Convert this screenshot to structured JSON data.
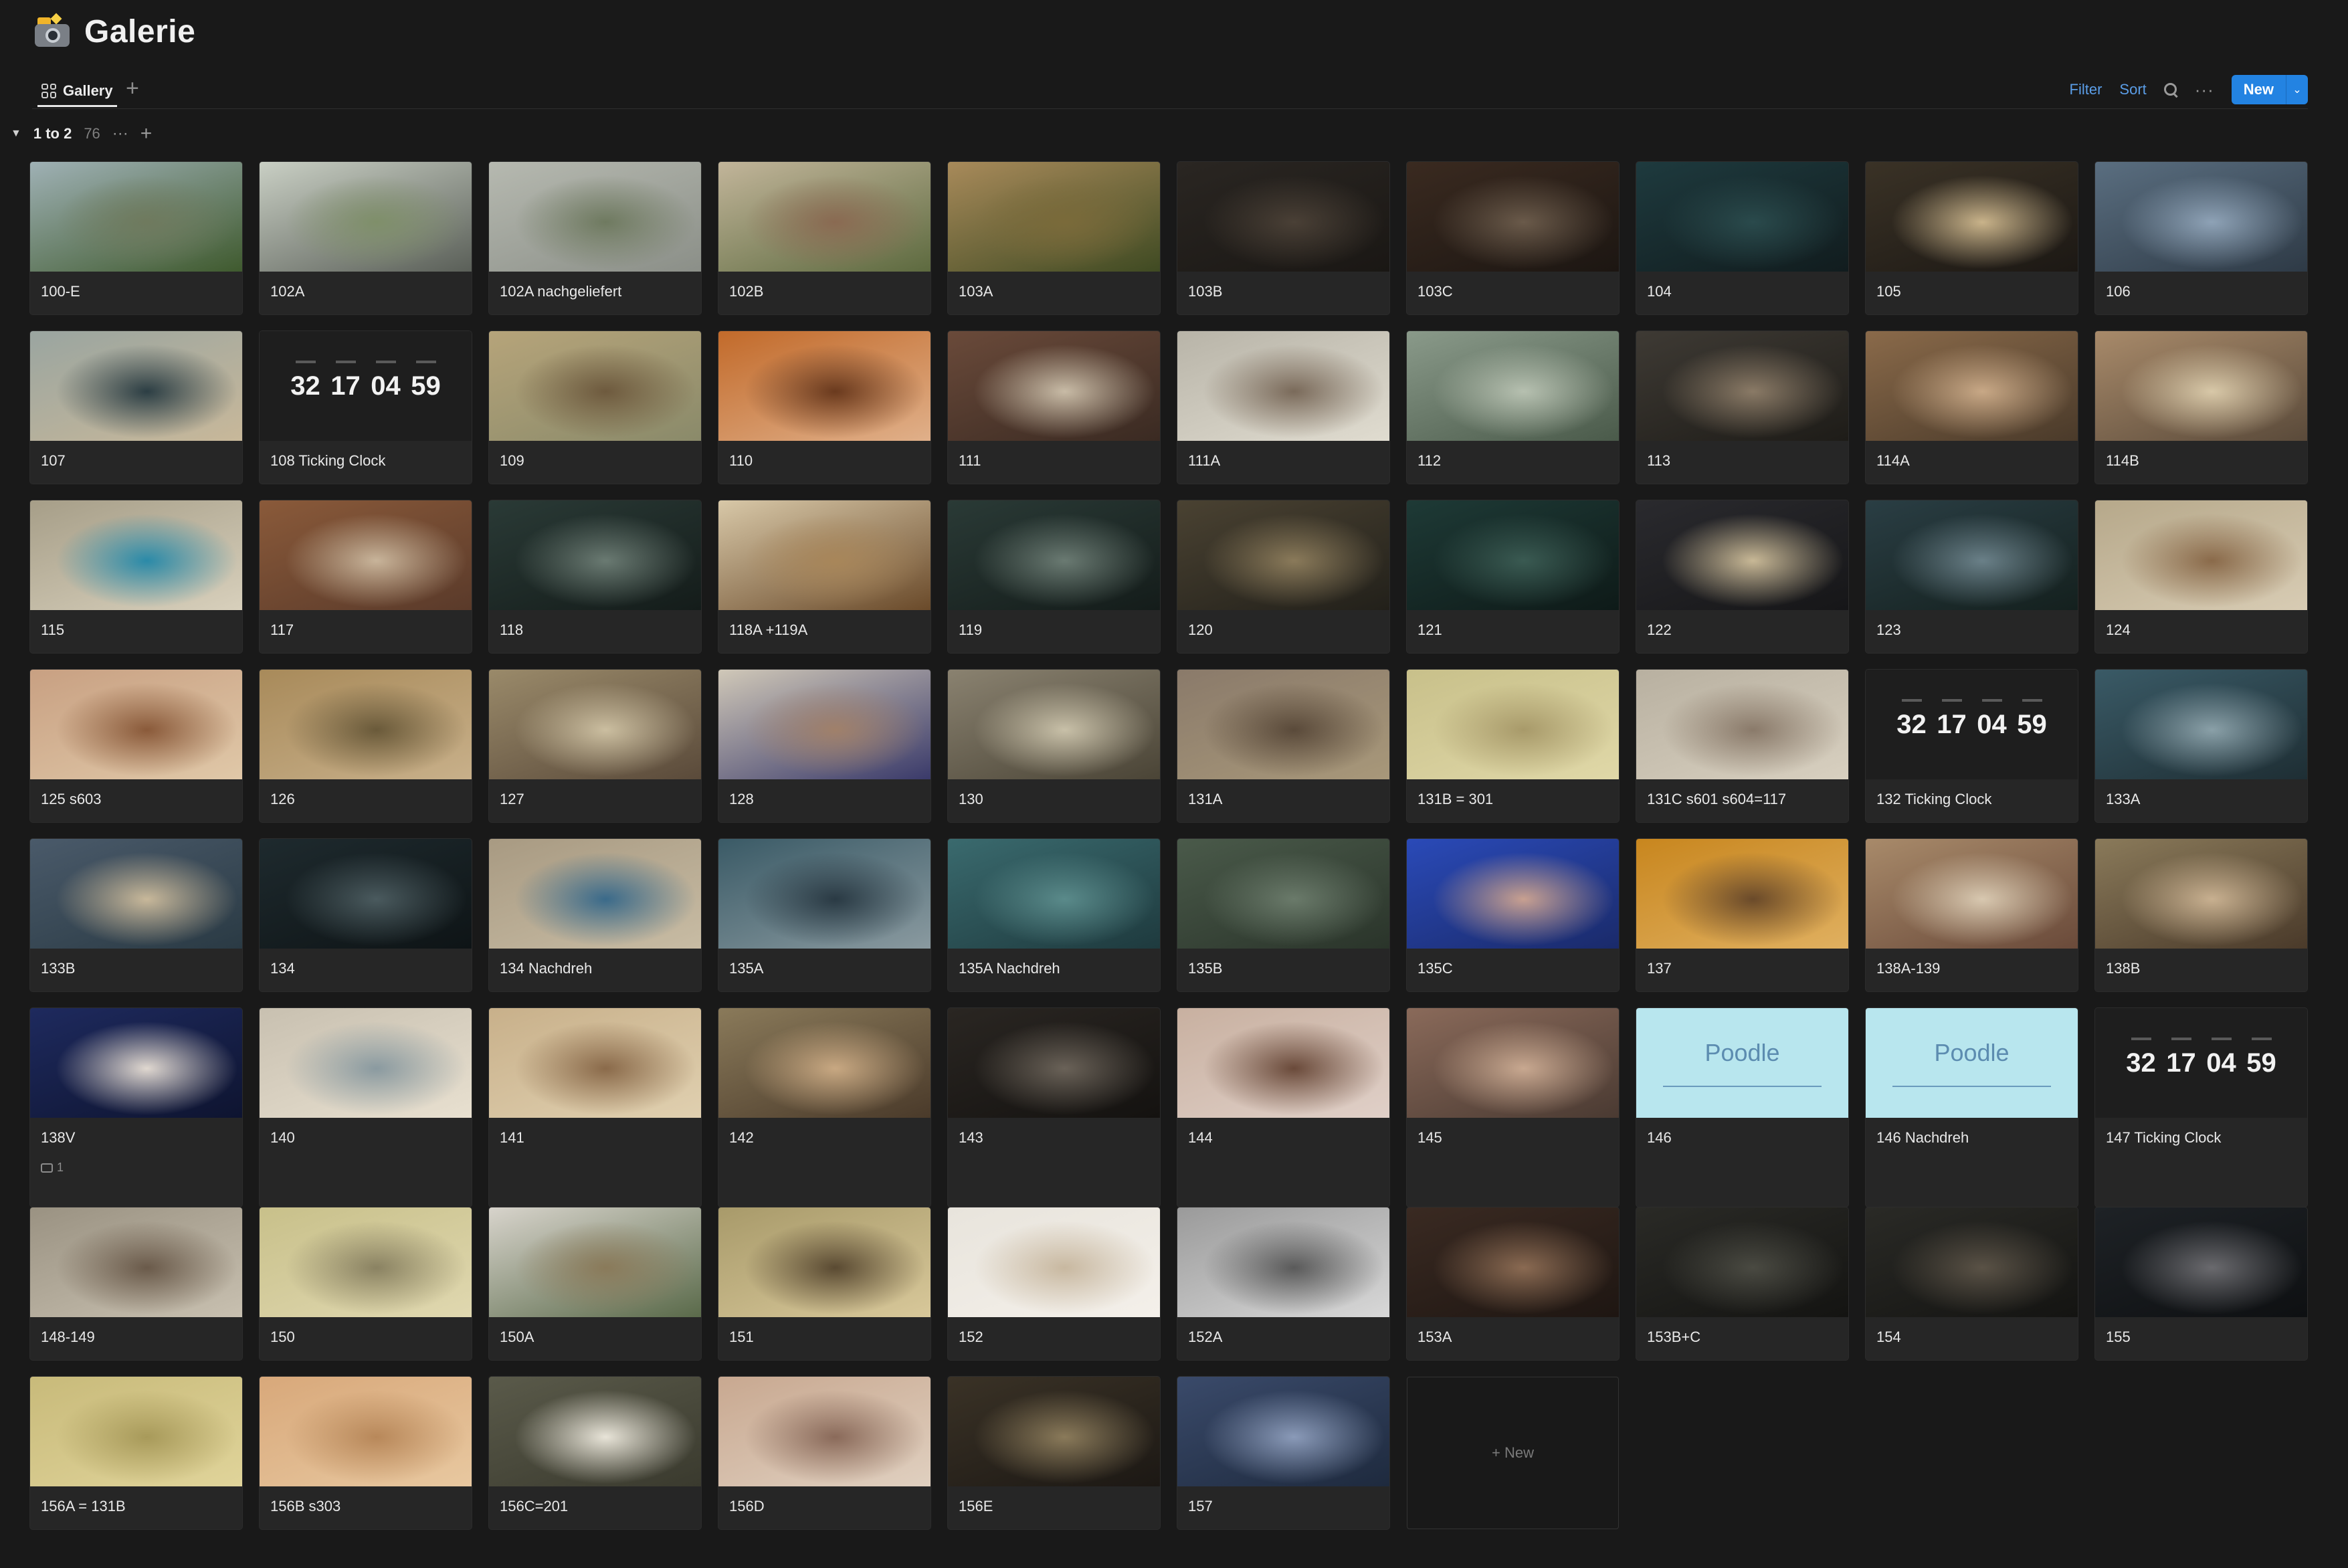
{
  "page": {
    "title": "Galerie"
  },
  "views": {
    "tabs": [
      {
        "label": "Gallery"
      }
    ]
  },
  "toolbar": {
    "filter": "Filter",
    "sort": "Sort",
    "new": "New"
  },
  "group": {
    "title": "1 to 2",
    "count": "76"
  },
  "cards": [
    {
      "title": "100-E",
      "thumb": "landscape",
      "palette": [
        "#9fb1b5",
        "#6f7a5e",
        "#3f5a2e"
      ]
    },
    {
      "title": "102A",
      "thumb": "photo",
      "palette": [
        "#c9cfc4",
        "#7f8f6a",
        "#5a5f58"
      ]
    },
    {
      "title": "102A nachgeliefert",
      "thumb": "photo",
      "palette": [
        "#b6b9b0",
        "#6f7a60",
        "#8b8f88"
      ]
    },
    {
      "title": "102B",
      "thumb": "photo",
      "palette": [
        "#c2b59a",
        "#8a6a52",
        "#5d6a3f"
      ]
    },
    {
      "title": "103A",
      "thumb": "photo",
      "palette": [
        "#a88a5a",
        "#7a6a3a",
        "#3f4a22"
      ]
    },
    {
      "title": "103B",
      "thumb": "dark",
      "palette": [
        "#2a2622",
        "#4a4036",
        "#1a1714"
      ]
    },
    {
      "title": "103C",
      "thumb": "dark",
      "palette": [
        "#3a2a20",
        "#6a5a4a",
        "#1c1612"
      ]
    },
    {
      "title": "104",
      "thumb": "dark",
      "palette": [
        "#1e3a3e",
        "#2a4a4c",
        "#111c1e"
      ]
    },
    {
      "title": "105",
      "thumb": "dark",
      "palette": [
        "#3a3226",
        "#c9b38a",
        "#1c1814"
      ]
    },
    {
      "title": "106",
      "thumb": "photo",
      "palette": [
        "#5a6e80",
        "#8ea2b6",
        "#2e3a46"
      ]
    },
    {
      "title": "107",
      "thumb": "photo",
      "palette": [
        "#9aa5a0",
        "#2c3e44",
        "#c8b89a"
      ]
    },
    {
      "title": "108 Ticking Clock",
      "thumb": "clock",
      "clock": [
        "32",
        "17",
        "04",
        "59"
      ]
    },
    {
      "title": "109",
      "thumb": "photo",
      "palette": [
        "#b6a47a",
        "#6e5a3e",
        "#8a8a6a"
      ]
    },
    {
      "title": "110",
      "thumb": "photo",
      "palette": [
        "#c26a2a",
        "#6a3a1e",
        "#e0b08a"
      ]
    },
    {
      "title": "111",
      "thumb": "photo",
      "palette": [
        "#6a4a3a",
        "#c8bba6",
        "#3a2a22"
      ]
    },
    {
      "title": "111A",
      "thumb": "photo",
      "palette": [
        "#b8b4a8",
        "#7a6a5a",
        "#e0dcd0"
      ]
    },
    {
      "title": "112",
      "thumb": "photo",
      "palette": [
        "#8a9a8a",
        "#b6c0b0",
        "#4a5a4a"
      ]
    },
    {
      "title": "113",
      "thumb": "dark",
      "palette": [
        "#3e3a34",
        "#8a7a66",
        "#1e1c18"
      ]
    },
    {
      "title": "114A",
      "thumb": "photo",
      "palette": [
        "#8a6a4a",
        "#c8a886",
        "#4a3a2a"
      ]
    },
    {
      "title": "114B",
      "thumb": "photo",
      "palette": [
        "#a88a6a",
        "#d8c8a8",
        "#5a4a3a"
      ]
    },
    {
      "title": "115",
      "thumb": "photo",
      "palette": [
        "#a69e88",
        "#2a8aa8",
        "#d8d0bc"
      ]
    },
    {
      "title": "117",
      "thumb": "photo",
      "palette": [
        "#8a5a3a",
        "#c8b49a",
        "#5a3a2a"
      ]
    },
    {
      "title": "118",
      "thumb": "dark",
      "palette": [
        "#2a3a36",
        "#6a7a72",
        "#141c1a"
      ]
    },
    {
      "title": "118A +119A",
      "thumb": "photo",
      "palette": [
        "#d8c8a8",
        "#a8865a",
        "#6a4a2a"
      ]
    },
    {
      "title": "119",
      "thumb": "dark",
      "palette": [
        "#2a3a36",
        "#6a7a72",
        "#141c1a"
      ]
    },
    {
      "title": "120",
      "thumb": "dark",
      "palette": [
        "#4a4232",
        "#8a7a5a",
        "#22201a"
      ]
    },
    {
      "title": "121",
      "thumb": "dark",
      "palette": [
        "#1e3a36",
        "#3a5a52",
        "#0e1a18"
      ]
    },
    {
      "title": "122",
      "thumb": "dark",
      "palette": [
        "#2a2a2e",
        "#c8b896",
        "#161618"
      ]
    },
    {
      "title": "123",
      "thumb": "dark",
      "palette": [
        "#2a3e44",
        "#6a8088",
        "#14201e"
      ]
    },
    {
      "title": "124",
      "thumb": "photo",
      "palette": [
        "#b6a88a",
        "#8a6a4a",
        "#d8ccb4"
      ]
    },
    {
      "title": "125 s603",
      "thumb": "photo",
      "palette": [
        "#c8a082",
        "#8a5a3a",
        "#e0c8a8"
      ]
    },
    {
      "title": "126",
      "thumb": "photo",
      "palette": [
        "#a88a5a",
        "#6a5a3a",
        "#c8b08a"
      ]
    },
    {
      "title": "127",
      "thumb": "photo",
      "palette": [
        "#9a8a6a",
        "#cbbea0",
        "#5a4a3a"
      ]
    },
    {
      "title": "128",
      "thumb": "photo",
      "palette": [
        "#d0c8b8",
        "#a0806a",
        "#3a3a6a"
      ]
    },
    {
      "title": "130",
      "thumb": "photo",
      "palette": [
        "#8a8270",
        "#c8c0a8",
        "#4a4436"
      ]
    },
    {
      "title": "131A",
      "thumb": "photo",
      "palette": [
        "#8a7a6a",
        "#5a4a3a",
        "#a8987a"
      ]
    },
    {
      "title": "131B = 301",
      "thumb": "photo",
      "palette": [
        "#c8c08a",
        "#a89a6a",
        "#e0d8a8"
      ]
    },
    {
      "title": "131C s601 s604=117",
      "thumb": "photo",
      "palette": [
        "#b8b0a0",
        "#8a7a6a",
        "#d8d0c0"
      ]
    },
    {
      "title": "132 Ticking Clock",
      "thumb": "clock",
      "clock": [
        "32",
        "17",
        "04",
        "59"
      ]
    },
    {
      "title": "133A",
      "thumb": "photo",
      "palette": [
        "#3a5a66",
        "#8aa0a8",
        "#1e2e34"
      ]
    },
    {
      "title": "133B",
      "thumb": "photo",
      "palette": [
        "#4a5a6a",
        "#c8b89a",
        "#2a3a44"
      ]
    },
    {
      "title": "134",
      "thumb": "dark",
      "palette": [
        "#1e2a2e",
        "#4a5a5e",
        "#0e1416"
      ]
    },
    {
      "title": "134 Nachdreh",
      "thumb": "photo",
      "palette": [
        "#a89a82",
        "#3a6a8a",
        "#c8bca4"
      ]
    },
    {
      "title": "135A",
      "thumb": "photo",
      "palette": [
        "#3a5a66",
        "#2a3a44",
        "#8a9aa0"
      ]
    },
    {
      "title": "135A Nachdreh",
      "thumb": "photo",
      "palette": [
        "#3a6a6e",
        "#5a8a8a",
        "#1e3a3e"
      ]
    },
    {
      "title": "135B",
      "thumb": "photo",
      "palette": [
        "#4a5a4a",
        "#6a7a6a",
        "#2a342a"
      ]
    },
    {
      "title": "135C",
      "thumb": "photo",
      "palette": [
        "#2a4ab8",
        "#c8a090",
        "#1a2a6a"
      ]
    },
    {
      "title": "137",
      "thumb": "photo",
      "palette": [
        "#c8861e",
        "#6a4a2a",
        "#e0b060"
      ]
    },
    {
      "title": "138A-139",
      "thumb": "photo",
      "palette": [
        "#a88a6a",
        "#d8c8b0",
        "#6a4a3a"
      ]
    },
    {
      "title": "138B",
      "thumb": "photo",
      "palette": [
        "#8a7a5a",
        "#c8b090",
        "#4a3a2a"
      ]
    },
    {
      "title": "138V",
      "thumb": "dark",
      "palette": [
        "#1e2a5e",
        "#e0d8d0",
        "#0e1430"
      ],
      "comments": "1"
    },
    {
      "title": "140",
      "thumb": "photo",
      "palette": [
        "#c8c0b0",
        "#8a9aa0",
        "#e8e0d0"
      ]
    },
    {
      "title": "141",
      "thumb": "photo",
      "palette": [
        "#c8b08a",
        "#8a6a4a",
        "#e0d0b0"
      ]
    },
    {
      "title": "142",
      "thumb": "photo",
      "palette": [
        "#8a7a5a",
        "#c8a882",
        "#4a3a2a"
      ]
    },
    {
      "title": "143",
      "thumb": "dark",
      "palette": [
        "#2a2622",
        "#6a6258",
        "#141210"
      ]
    },
    {
      "title": "144",
      "thumb": "photo",
      "palette": [
        "#c8b0a0",
        "#6a4a3a",
        "#e0d0c8"
      ]
    },
    {
      "title": "145",
      "thumb": "photo",
      "palette": [
        "#8a6a5a",
        "#c8a890",
        "#4a3a32"
      ]
    },
    {
      "title": "146",
      "thumb": "poodle",
      "logo": "Poodle"
    },
    {
      "title": "146 Nachdreh",
      "thumb": "poodle",
      "logo": "Poodle"
    },
    {
      "title": "147 Ticking Clock",
      "thumb": "clock",
      "clock": [
        "32",
        "17",
        "04",
        "59"
      ]
    },
    {
      "title": "148-149",
      "thumb": "photo",
      "palette": [
        "#9a9282",
        "#6a5a4a",
        "#c8c0b0"
      ]
    },
    {
      "title": "150",
      "thumb": "photo",
      "palette": [
        "#c8c08a",
        "#8a8262",
        "#e0d8b0"
      ]
    },
    {
      "title": "150A",
      "thumb": "photo",
      "palette": [
        "#d8d4cc",
        "#8a7a5a",
        "#5a6a4a"
      ]
    },
    {
      "title": "151",
      "thumb": "photo",
      "palette": [
        "#a89a6a",
        "#5a4a32",
        "#d8c89a"
      ]
    },
    {
      "title": "152",
      "thumb": "photo",
      "palette": [
        "#e8e4dc",
        "#c8b8a0",
        "#f4f0ea"
      ]
    },
    {
      "title": "152A",
      "thumb": "photo",
      "palette": [
        "#9a9a9a",
        "#5a5a5a",
        "#d8d8d8"
      ]
    },
    {
      "title": "153A",
      "thumb": "dark",
      "palette": [
        "#3a2a22",
        "#8a6a52",
        "#1e1612"
      ]
    },
    {
      "title": "153B+C",
      "thumb": "dark",
      "palette": [
        "#2a2a26",
        "#4a4a42",
        "#141412"
      ]
    },
    {
      "title": "154",
      "thumb": "dark",
      "palette": [
        "#2a2a26",
        "#5a5246",
        "#141412"
      ]
    },
    {
      "title": "155",
      "thumb": "dark",
      "palette": [
        "#1e2226",
        "#6a6a6e",
        "#0e1012"
      ]
    },
    {
      "title": "156A = 131B",
      "thumb": "photo",
      "palette": [
        "#c8ba7a",
        "#a89a5a",
        "#e0d49a"
      ]
    },
    {
      "title": "156B s303",
      "thumb": "photo",
      "palette": [
        "#d8a87a",
        "#b8885a",
        "#e8c8a0"
      ]
    },
    {
      "title": "156C=201",
      "thumb": "photo",
      "palette": [
        "#5a5a4a",
        "#e8e4d8",
        "#3a3a2e"
      ]
    },
    {
      "title": "156D",
      "thumb": "photo",
      "palette": [
        "#c8a890",
        "#8a6a5a",
        "#e0d0c0"
      ]
    },
    {
      "title": "156E",
      "thumb": "dark",
      "palette": [
        "#3a3226",
        "#8a7a5a",
        "#1c1814"
      ]
    },
    {
      "title": "157",
      "thumb": "photo",
      "palette": [
        "#3a4a6a",
        "#8a9ab8",
        "#1e2a3e"
      ]
    }
  ],
  "new_card": {
    "label": "+ New"
  },
  "icons": {
    "page": "camera-flash-icon",
    "view": "grid-icon",
    "search": "search-icon",
    "more": "more-icon"
  }
}
